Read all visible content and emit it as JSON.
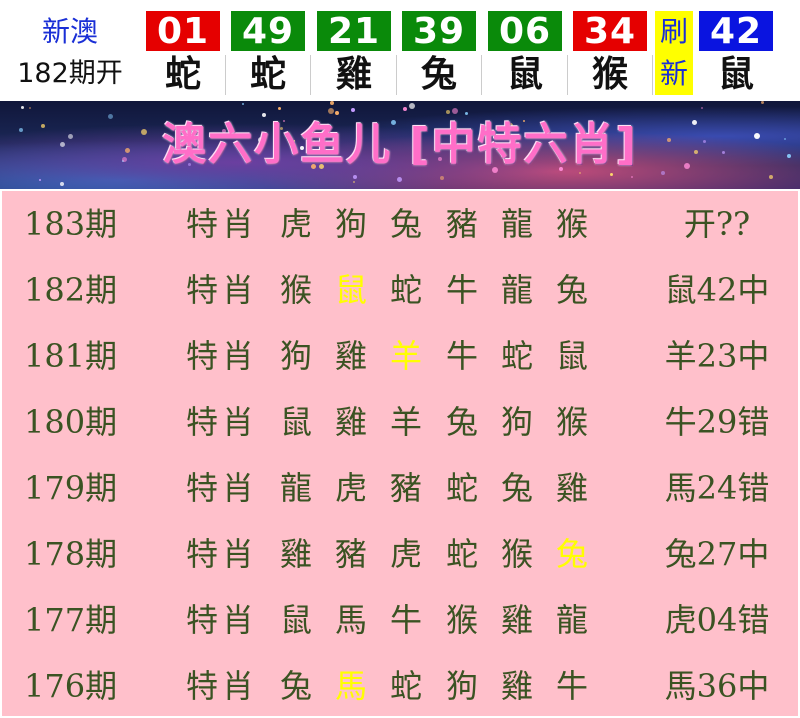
{
  "header": {
    "brand_line1": "新澳",
    "brand_line2": "182期开",
    "balls": [
      {
        "num": "01",
        "zodiac": "蛇",
        "color": "#e50000"
      },
      {
        "num": "49",
        "zodiac": "蛇",
        "color": "#0a8a0a"
      },
      {
        "num": "21",
        "zodiac": "雞",
        "color": "#0a8a0a"
      },
      {
        "num": "39",
        "zodiac": "兔",
        "color": "#0a8a0a"
      },
      {
        "num": "06",
        "zodiac": "鼠",
        "color": "#0a8a0a"
      },
      {
        "num": "34",
        "zodiac": "猴",
        "color": "#e50000"
      }
    ],
    "refresh": [
      "刷",
      "新"
    ],
    "special": {
      "num": "42",
      "zodiac": "鼠",
      "color": "#0a14e0"
    }
  },
  "banner": {
    "title": "澳六小鱼儿 [中特六肖]"
  },
  "colors": {
    "table_bg": "#ffc0cb",
    "text": "#3b5323",
    "highlight": "#ffff00"
  },
  "rows": [
    {
      "issue": "183期",
      "label": "特肖",
      "zodiacs": [
        "虎",
        "狗",
        "兔",
        "豬",
        "龍",
        "猴"
      ],
      "hit_index": -1,
      "result": "开??"
    },
    {
      "issue": "182期",
      "label": "特肖",
      "zodiacs": [
        "猴",
        "鼠",
        "蛇",
        "牛",
        "龍",
        "兔"
      ],
      "hit_index": 1,
      "result": "鼠42中"
    },
    {
      "issue": "181期",
      "label": "特肖",
      "zodiacs": [
        "狗",
        "雞",
        "羊",
        "牛",
        "蛇",
        "鼠"
      ],
      "hit_index": 2,
      "result": "羊23中"
    },
    {
      "issue": "180期",
      "label": "特肖",
      "zodiacs": [
        "鼠",
        "雞",
        "羊",
        "兔",
        "狗",
        "猴"
      ],
      "hit_index": -1,
      "result": "牛29错"
    },
    {
      "issue": "179期",
      "label": "特肖",
      "zodiacs": [
        "龍",
        "虎",
        "豬",
        "蛇",
        "兔",
        "雞"
      ],
      "hit_index": -1,
      "result": "馬24错"
    },
    {
      "issue": "178期",
      "label": "特肖",
      "zodiacs": [
        "雞",
        "豬",
        "虎",
        "蛇",
        "猴",
        "兔"
      ],
      "hit_index": 5,
      "result": "兔27中"
    },
    {
      "issue": "177期",
      "label": "特肖",
      "zodiacs": [
        "鼠",
        "馬",
        "牛",
        "猴",
        "雞",
        "龍"
      ],
      "hit_index": -1,
      "result": "虎04错"
    },
    {
      "issue": "176期",
      "label": "特肖",
      "zodiacs": [
        "兔",
        "馬",
        "蛇",
        "狗",
        "雞",
        "牛"
      ],
      "hit_index": 1,
      "result": "馬36中"
    }
  ]
}
